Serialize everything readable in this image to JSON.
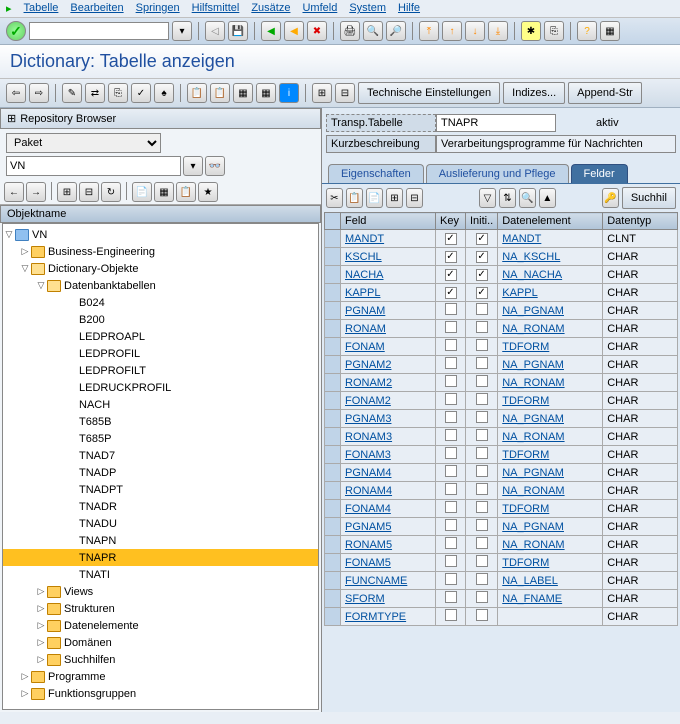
{
  "menu": [
    "Tabelle",
    "Bearbeiten",
    "Springen",
    "Hilfsmittel",
    "Zusätze",
    "Umfeld",
    "System",
    "Hilfe"
  ],
  "title": "Dictionary: Tabelle anzeigen",
  "toolbar2_buttons": {
    "tech": "Technische Einstellungen",
    "idx": "Indizes...",
    "app": "Append-Str"
  },
  "repo_header": "Repository Browser",
  "pkg_label": "Paket",
  "pkg_value": "VN",
  "obj_header": "Objektname",
  "tree": {
    "root": "VN",
    "beng": "Business-Engineering",
    "dicto": "Dictionary-Objekte",
    "dbtab": "Datenbanktabellen",
    "tables": [
      "B024",
      "B200",
      "LEDPROAPL",
      "LEDPROFIL",
      "LEDPROFILT",
      "LEDRUCKPROFIL",
      "NACH",
      "T685B",
      "T685P",
      "TNAD7",
      "TNADP",
      "TNADPT",
      "TNADR",
      "TNADU",
      "TNAPN",
      "TNAPR",
      "TNATI"
    ],
    "selected": "TNAPR",
    "more": [
      "Views",
      "Strukturen",
      "Datenelemente",
      "Domänen",
      "Suchhilfen"
    ],
    "more2": [
      "Programme",
      "Funktionsgruppen"
    ]
  },
  "info": {
    "transp_lbl": "Transp.Tabelle",
    "transp_val": "TNAPR",
    "status": "aktiv",
    "kurz_lbl": "Kurzbeschreibung",
    "kurz_val": "Verarbeitungsprogramme für Nachrichten"
  },
  "tabs": {
    "t1": "Eigenschaften",
    "t2": "Auslieferung und Pflege",
    "t3": "Felder"
  },
  "search_btn": "Suchhil",
  "cols": {
    "feld": "Feld",
    "key": "Key",
    "init": "Initi..",
    "de": "Datenelement",
    "dt": "Datentyp"
  },
  "rows": [
    {
      "f": "MANDT",
      "k": true,
      "i": true,
      "de": "MANDT",
      "dt": "CLNT"
    },
    {
      "f": "KSCHL",
      "k": true,
      "i": true,
      "de": "NA_KSCHL",
      "dt": "CHAR"
    },
    {
      "f": "NACHA",
      "k": true,
      "i": true,
      "de": "NA_NACHA",
      "dt": "CHAR"
    },
    {
      "f": "KAPPL",
      "k": true,
      "i": true,
      "de": "KAPPL",
      "dt": "CHAR"
    },
    {
      "f": "PGNAM",
      "k": false,
      "i": false,
      "de": "NA_PGNAM",
      "dt": "CHAR"
    },
    {
      "f": "RONAM",
      "k": false,
      "i": false,
      "de": "NA_RONAM",
      "dt": "CHAR"
    },
    {
      "f": "FONAM",
      "k": false,
      "i": false,
      "de": "TDFORM",
      "dt": "CHAR"
    },
    {
      "f": "PGNAM2",
      "k": false,
      "i": false,
      "de": "NA_PGNAM",
      "dt": "CHAR"
    },
    {
      "f": "RONAM2",
      "k": false,
      "i": false,
      "de": "NA_RONAM",
      "dt": "CHAR"
    },
    {
      "f": "FONAM2",
      "k": false,
      "i": false,
      "de": "TDFORM",
      "dt": "CHAR"
    },
    {
      "f": "PGNAM3",
      "k": false,
      "i": false,
      "de": "NA_PGNAM",
      "dt": "CHAR"
    },
    {
      "f": "RONAM3",
      "k": false,
      "i": false,
      "de": "NA_RONAM",
      "dt": "CHAR"
    },
    {
      "f": "FONAM3",
      "k": false,
      "i": false,
      "de": "TDFORM",
      "dt": "CHAR"
    },
    {
      "f": "PGNAM4",
      "k": false,
      "i": false,
      "de": "NA_PGNAM",
      "dt": "CHAR"
    },
    {
      "f": "RONAM4",
      "k": false,
      "i": false,
      "de": "NA_RONAM",
      "dt": "CHAR"
    },
    {
      "f": "FONAM4",
      "k": false,
      "i": false,
      "de": "TDFORM",
      "dt": "CHAR"
    },
    {
      "f": "PGNAM5",
      "k": false,
      "i": false,
      "de": "NA_PGNAM",
      "dt": "CHAR"
    },
    {
      "f": "RONAM5",
      "k": false,
      "i": false,
      "de": "NA_RONAM",
      "dt": "CHAR"
    },
    {
      "f": "FONAM5",
      "k": false,
      "i": false,
      "de": "TDFORM",
      "dt": "CHAR"
    },
    {
      "f": "FUNCNAME",
      "k": false,
      "i": false,
      "de": "NA_LABEL",
      "dt": "CHAR"
    },
    {
      "f": "SFORM",
      "k": false,
      "i": false,
      "de": "NA_FNAME",
      "dt": "CHAR"
    },
    {
      "f": "FORMTYPE",
      "k": false,
      "i": false,
      "de": "",
      "dt": "CHAR"
    }
  ]
}
